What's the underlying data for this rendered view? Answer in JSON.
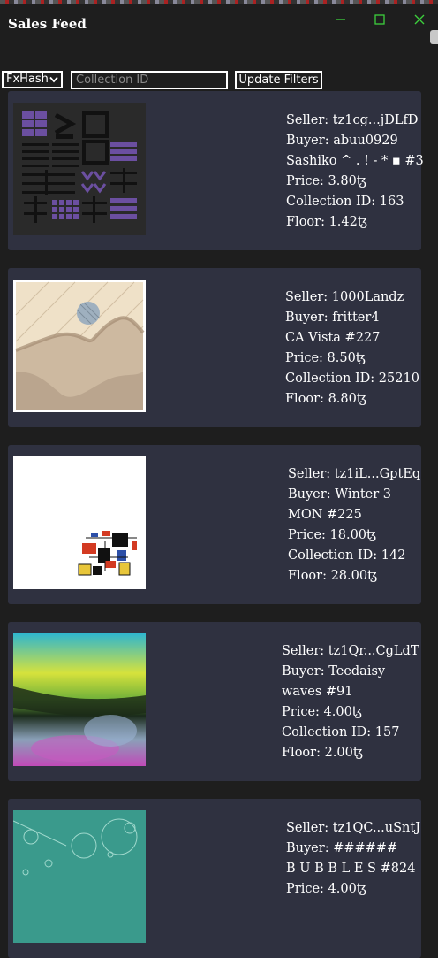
{
  "window": {
    "title": "Sales Feed",
    "controls": [
      "minimize",
      "maximize",
      "close"
    ]
  },
  "filters": {
    "platform_selected": "FxHash",
    "collection_placeholder": "Collection ID",
    "update_label": "Update Filters"
  },
  "sales": [
    {
      "seller": "Seller: tz1cg...jDLfD",
      "buyer": "Buyer: abuu0929",
      "title": "Sashiko ^ . ! - * ▪ #3",
      "price": "Price: 3.80ꜩ",
      "collection": "Collection ID: 163",
      "floor": "Floor: 1.42ꜩ"
    },
    {
      "seller": "Seller: 1000Landz",
      "buyer": "Buyer: fritter4",
      "title": "CA Vista #227",
      "price": "Price: 8.50ꜩ",
      "collection": "Collection ID: 25210",
      "floor": "Floor: 8.80ꜩ"
    },
    {
      "seller": "Seller: tz1iL...GptEq",
      "buyer": "Buyer: Winter 3",
      "title": "MON #225",
      "price": "Price: 18.00ꜩ",
      "collection": "Collection ID: 142",
      "floor": "Floor: 28.00ꜩ"
    },
    {
      "seller": "Seller: tz1Qr...CgLdT",
      "buyer": "Buyer: Teedaisy",
      "title": "waves #91",
      "price": "Price: 4.00ꜩ",
      "collection": "Collection ID: 157",
      "floor": "Floor: 2.00ꜩ"
    },
    {
      "seller": "Seller: tz1QC...uSntJ",
      "buyer": "Buyer: ######",
      "title": "B U B B L E S #824",
      "price": "Price: 4.00ꜩ",
      "collection": "",
      "floor": ""
    }
  ]
}
